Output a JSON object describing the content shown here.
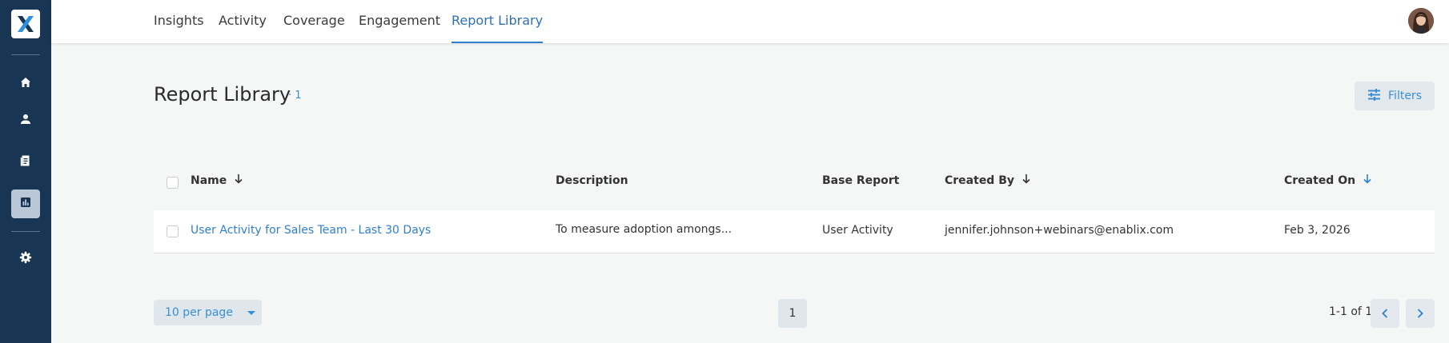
{
  "nav": {
    "tabs": [
      {
        "label": "Insights"
      },
      {
        "label": "Activity"
      },
      {
        "label": "Coverage"
      },
      {
        "label": "Engagement"
      },
      {
        "label": "Report Library",
        "active": true
      }
    ]
  },
  "sidebar": {
    "items": [
      {
        "icon": "home-icon"
      },
      {
        "icon": "user-icon"
      },
      {
        "icon": "document-icon"
      },
      {
        "icon": "bar-chart-icon",
        "active": true
      },
      {
        "icon": "gear-icon"
      }
    ]
  },
  "page": {
    "title": "Report Library",
    "count": "· 1",
    "filters_label": "Filters"
  },
  "table": {
    "columns": [
      "Name",
      "Description",
      "Base Report",
      "Created By",
      "Created On"
    ],
    "rows": [
      {
        "name": "User Activity for Sales Team - Last 30 Days",
        "description": "To measure adoption amongs...",
        "base_report": "User Activity",
        "created_by": "jennifer.johnson+webinars@enablix.com",
        "created_on": "Feb 3, 2026"
      }
    ]
  },
  "pagination": {
    "per_page": "10 per page",
    "current_page": "1",
    "range": "1-1 of 1"
  },
  "colors": {
    "sidebar_bg": "#193554",
    "accent": "#2f7fd0",
    "page_bg": "#f5f6f6"
  }
}
